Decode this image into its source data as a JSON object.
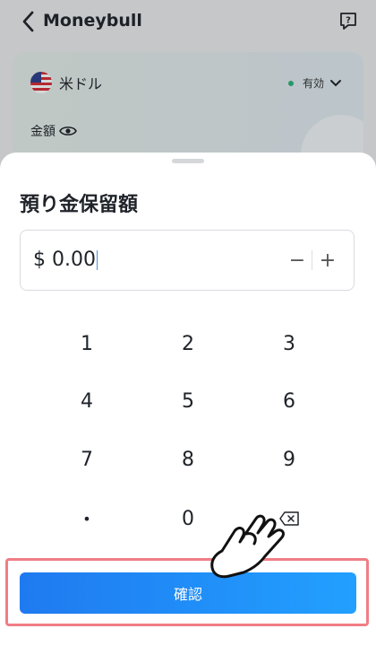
{
  "header": {
    "title": "Moneybull",
    "back_icon": "chevron-left-icon",
    "help_icon": "help-chat-icon"
  },
  "account_card": {
    "currency_name": "米ドル",
    "status": "有効",
    "amount_label": "金額"
  },
  "sheet": {
    "title": "預り金保留額",
    "amount_value": "$ 0.00",
    "minus_label": "−",
    "plus_label": "+"
  },
  "keypad": {
    "keys": [
      "1",
      "2",
      "3",
      "4",
      "5",
      "6",
      "7",
      "8",
      "9",
      "•",
      "0"
    ]
  },
  "confirm_button": {
    "label": "確認"
  },
  "colors": {
    "accent": "#1f7af0",
    "highlight": "#f07d86",
    "status_green": "#2bb37a"
  }
}
